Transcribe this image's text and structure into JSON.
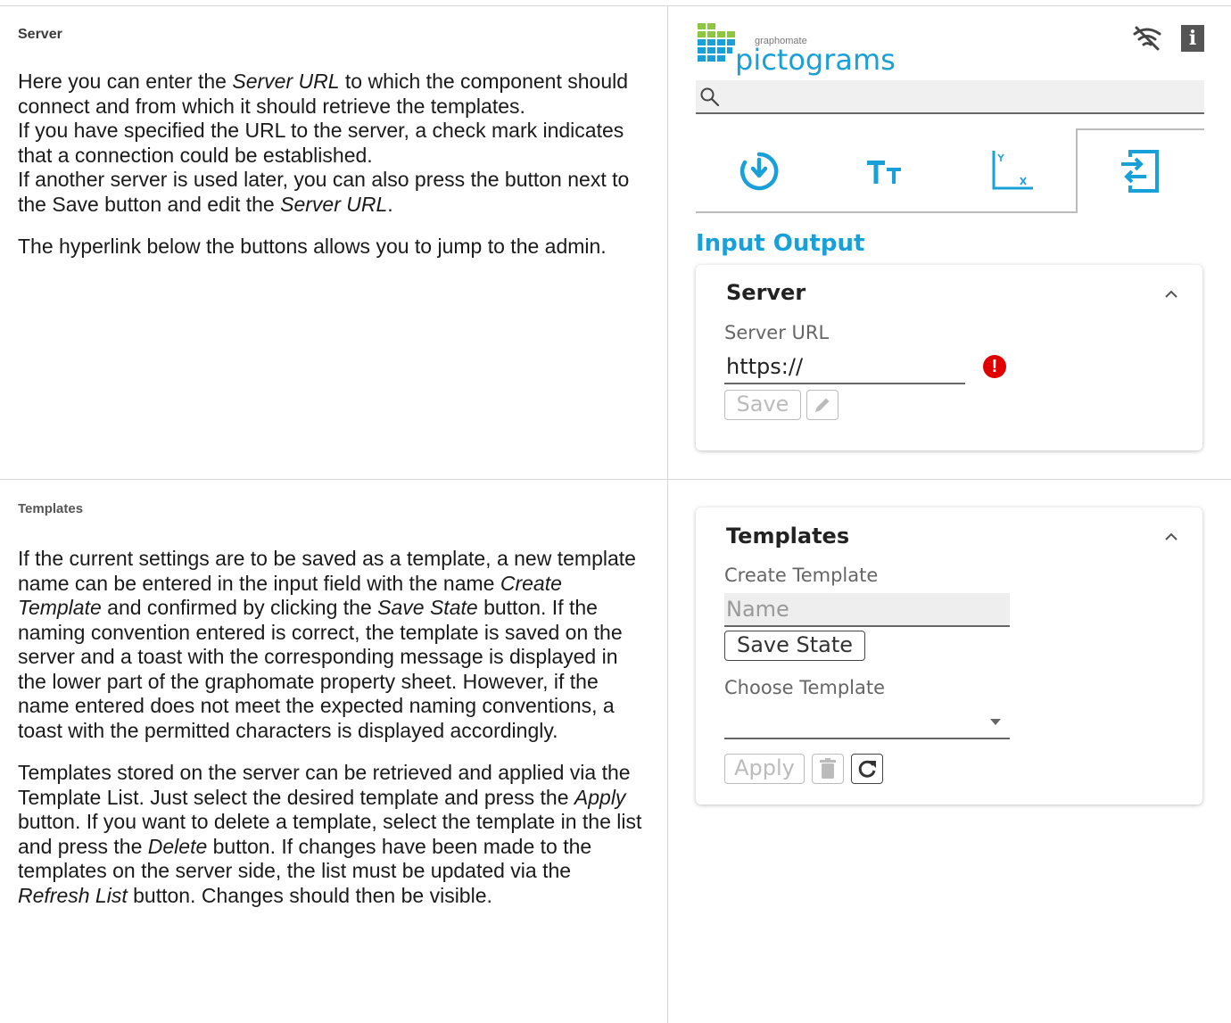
{
  "server_section": {
    "title": "Server",
    "p1_a": "Here you can enter the ",
    "p1_em1": "Server URL",
    "p1_b": " to which the component should connect and from which it should retrieve the templates.",
    "p1_c": "If you have specified the URL to the server, a check mark indicates that a connection could be established.",
    "p1_d": "If another server is used later, you can also press the button next to the Save button and edit the ",
    "p1_em2": "Server URL",
    "p1_e": ".",
    "p2": "The hyperlink below the buttons allows you to jump to the admin."
  },
  "templates_section": {
    "title": "Templates",
    "p1_a": "If the current settings are to be saved as a template, a new template name can be entered in the input field with the name ",
    "p1_em1": "Create Template",
    "p1_b": " and confirmed by clicking the ",
    "p1_em2": "Save State",
    "p1_c": " button. If the naming convention entered is correct, the template is saved on the server and a toast with the corresponding message is displayed in the lower part of the graphomate property sheet. However, if the name entered does not meet the expected naming conventions, a toast with the permitted characters is displayed accordingly.",
    "p2_a": "Templates stored on the server can be retrieved and applied via the Template List. Just select the desired template and press the ",
    "p2_em1": "Apply",
    "p2_b": " button. If you want to delete a template, select the template in the list and press the ",
    "p2_em2": "Delete",
    "p2_c": " button. If changes have been made to the templates on the server side, the list must be updated via the ",
    "p2_em3": "Refresh List",
    "p2_d": " button. Changes should then be visible."
  },
  "panel": {
    "logo_small": "graphomate",
    "logo_big": "pictograms",
    "info_label": "i",
    "section_heading": "Input Output",
    "server_card": {
      "title": "Server",
      "field_label": "Server URL",
      "field_value": "https://",
      "error_mark": "!",
      "save_label": "Save"
    },
    "templates_card": {
      "title": "Templates",
      "create_label": "Create Template",
      "name_placeholder": "Name",
      "save_state_label": "Save State",
      "choose_label": "Choose Template",
      "apply_label": "Apply"
    }
  },
  "colors": {
    "accent": "#1aa0d8",
    "logo_green": "#8dc63f",
    "error": "#e00000"
  }
}
